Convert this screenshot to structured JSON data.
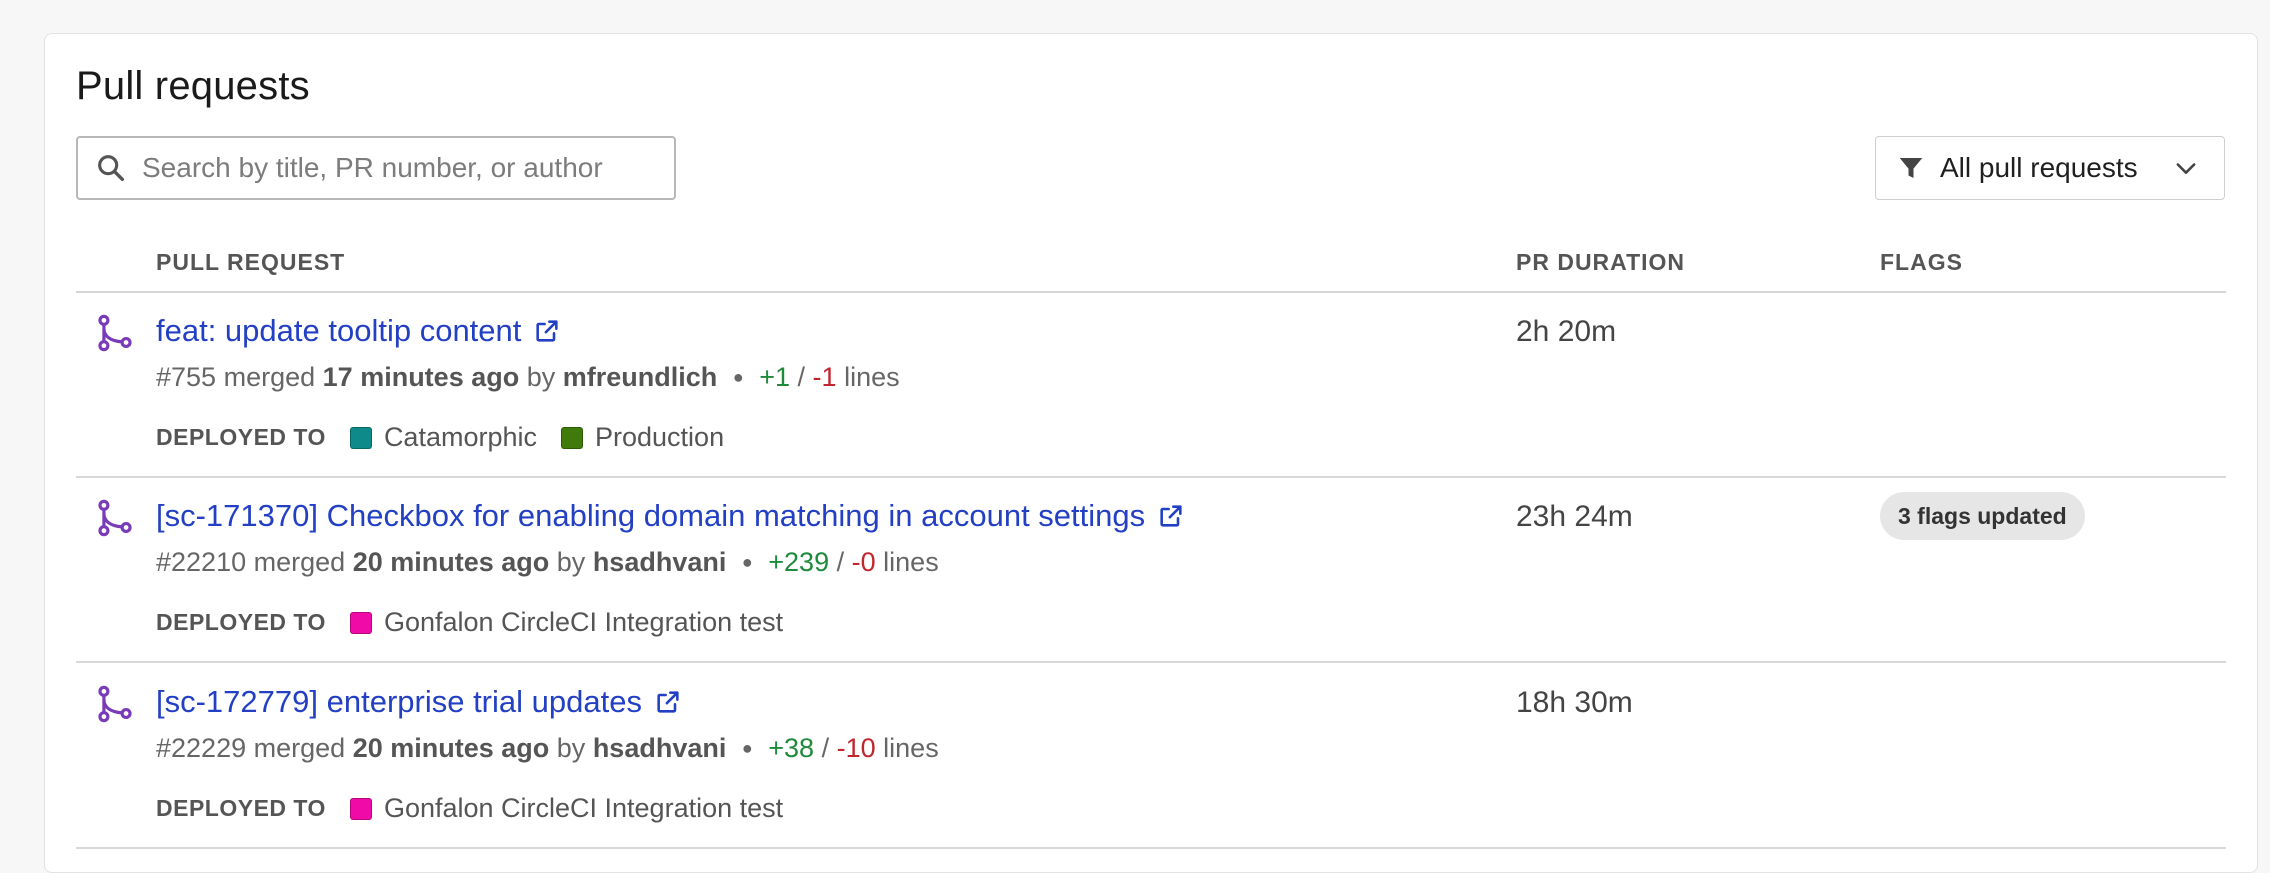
{
  "page": {
    "title": "Pull requests"
  },
  "search": {
    "placeholder": "Search by title, PR number, or author",
    "icon": "search-icon"
  },
  "filter": {
    "label": "All pull requests",
    "icon": "filter-icon",
    "chevron": "chevron-down-icon"
  },
  "table": {
    "headers": {
      "pull_request": "PULL REQUEST",
      "duration": "PR DURATION",
      "flags": "FLAGS"
    },
    "deployed_label": "DEPLOYED TO",
    "rows": [
      {
        "title": "feat: update tooltip content",
        "number": "#755",
        "merged_word": "merged",
        "time": "17 minutes ago",
        "by_word": "by",
        "author": "mfreundlich",
        "additions": "+1",
        "sep": "/",
        "deletions": "-1",
        "lines_word": "lines",
        "environments": [
          {
            "name": "Catamorphic",
            "color": "#0e8a8a"
          },
          {
            "name": "Production",
            "color": "#3f7a0a"
          }
        ],
        "duration": "2h 20m",
        "flags": ""
      },
      {
        "title": "[sc-171370] Checkbox for enabling domain matching in account settings",
        "number": "#22210",
        "merged_word": "merged",
        "time": "20 minutes ago",
        "by_word": "by",
        "author": "hsadhvani",
        "additions": "+239",
        "sep": "/",
        "deletions": "-0",
        "lines_word": "lines",
        "environments": [
          {
            "name": "Gonfalon CircleCI Integration test",
            "color": "#f00aa8"
          }
        ],
        "duration": "23h 24m",
        "flags": "3 flags updated"
      },
      {
        "title": "[sc-172779] enterprise trial updates",
        "number": "#22229",
        "merged_word": "merged",
        "time": "20 minutes ago",
        "by_word": "by",
        "author": "hsadhvani",
        "additions": "+38",
        "sep": "/",
        "deletions": "-10",
        "lines_word": "lines",
        "environments": [
          {
            "name": "Gonfalon CircleCI Integration test",
            "color": "#f00aa8"
          }
        ],
        "duration": "18h 30m",
        "flags": ""
      }
    ]
  },
  "colors": {
    "link": "#2340c4",
    "merged_icon": "#7a3bb8",
    "additions": "#1f8a3b",
    "deletions": "#c0262e"
  }
}
